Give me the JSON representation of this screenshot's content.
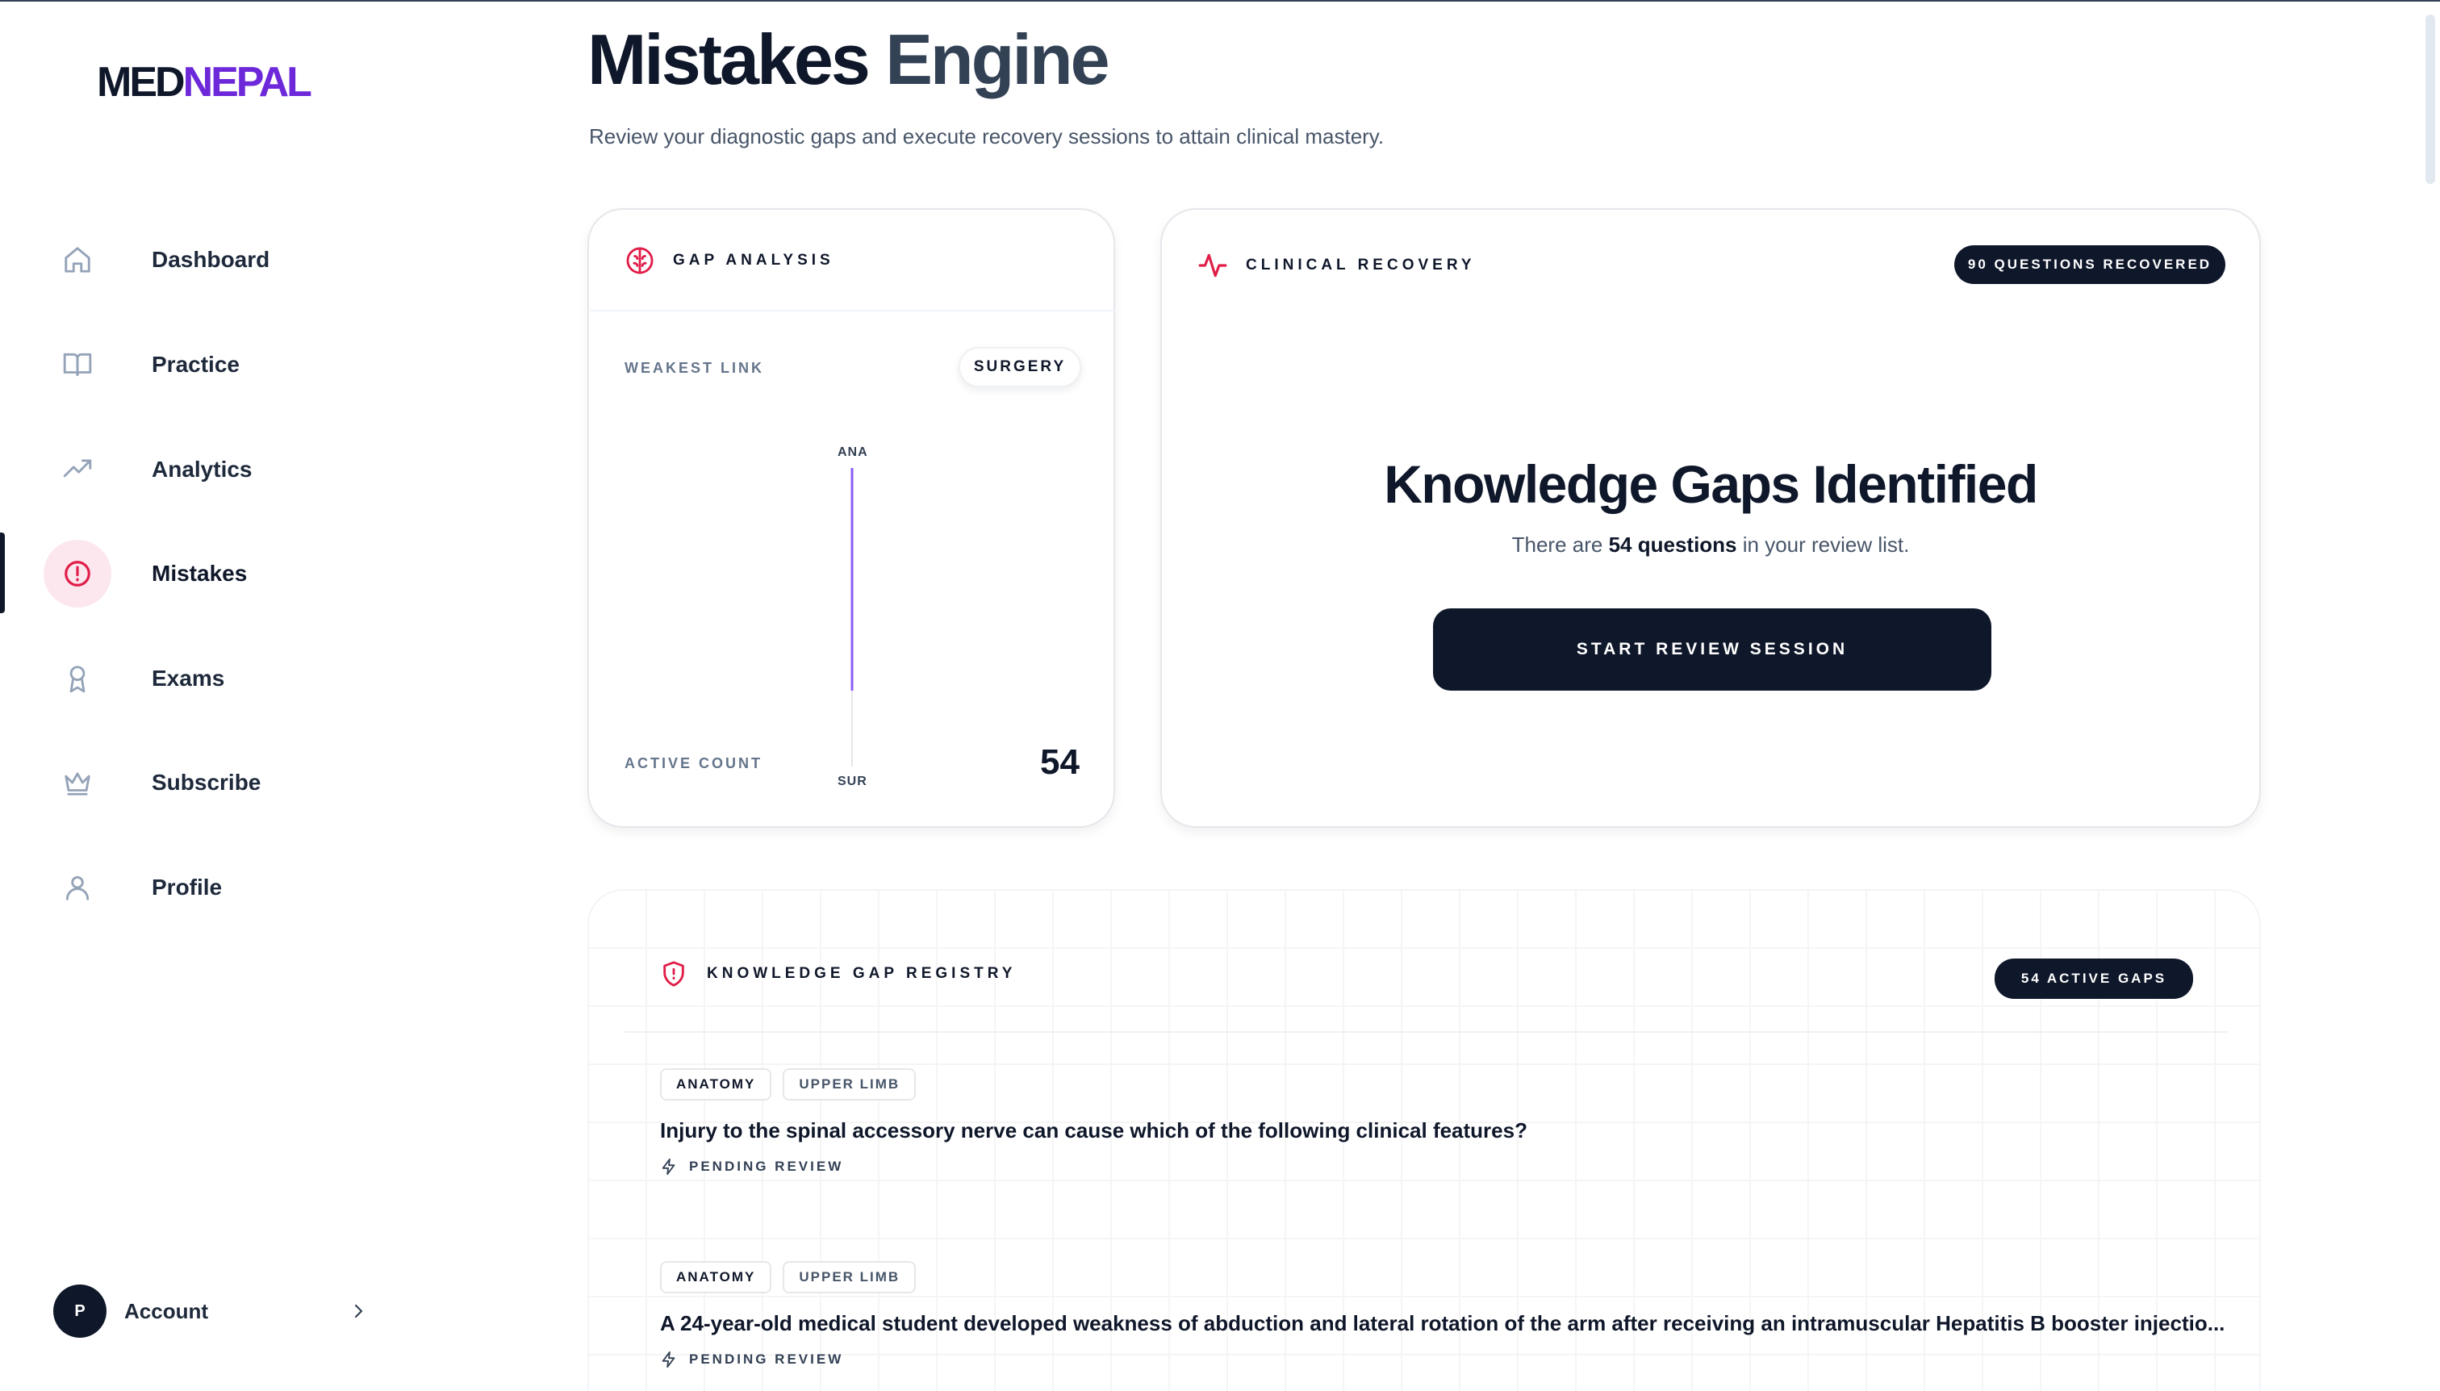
{
  "brand": {
    "part1": "MED",
    "part2": "NEPAL"
  },
  "sidebar": {
    "items": [
      {
        "label": "Dashboard",
        "icon": "home-icon"
      },
      {
        "label": "Practice",
        "icon": "book-icon"
      },
      {
        "label": "Analytics",
        "icon": "trending-up-icon"
      },
      {
        "label": "Mistakes",
        "icon": "alert-circle-icon",
        "active": true
      },
      {
        "label": "Exams",
        "icon": "award-icon"
      },
      {
        "label": "Subscribe",
        "icon": "crown-icon"
      },
      {
        "label": "Profile",
        "icon": "user-icon"
      }
    ],
    "account": {
      "initial": "P",
      "label": "Account"
    }
  },
  "header": {
    "title_part1": "Mistakes",
    "title_part2": "Engine",
    "subtitle": "Review your diagnostic gaps and execute recovery sessions to attain clinical mastery."
  },
  "gap_analysis": {
    "title": "GAP ANALYSIS",
    "weakest_link_label": "WEAKEST LINK",
    "weakest_link_value": "SURGERY",
    "chart_top_label": "ANA",
    "chart_bottom_label": "SUR",
    "active_count_label": "ACTIVE COUNT",
    "active_count_value": "54"
  },
  "clinical_recovery": {
    "title": "CLINICAL RECOVERY",
    "badge": "90 QUESTIONS RECOVERED",
    "heading": "Knowledge Gaps Identified",
    "sub_prefix": "There are",
    "sub_bold": "54 questions",
    "sub_suffix": "in your review list.",
    "button": "START REVIEW SESSION"
  },
  "registry": {
    "title": "KNOWLEDGE GAP REGISTRY",
    "badge": "54 ACTIVE GAPS",
    "items": [
      {
        "tags": [
          "ANATOMY",
          "UPPER LIMB"
        ],
        "question": "Injury to the spinal accessory nerve can cause which of the following clinical features?",
        "status": "PENDING REVIEW"
      },
      {
        "tags": [
          "ANATOMY",
          "UPPER LIMB"
        ],
        "question": "A 24-year-old medical student developed weakness of abduction and lateral rotation of the arm after receiving an intramuscular Hepatitis B booster injectio...",
        "status": "PENDING REVIEW"
      }
    ]
  },
  "colors": {
    "brand_dark": "#0f172a",
    "brand_purple": "#6d28d9",
    "accent_red": "#e11d48",
    "chart_line": "#8b5cf6"
  }
}
